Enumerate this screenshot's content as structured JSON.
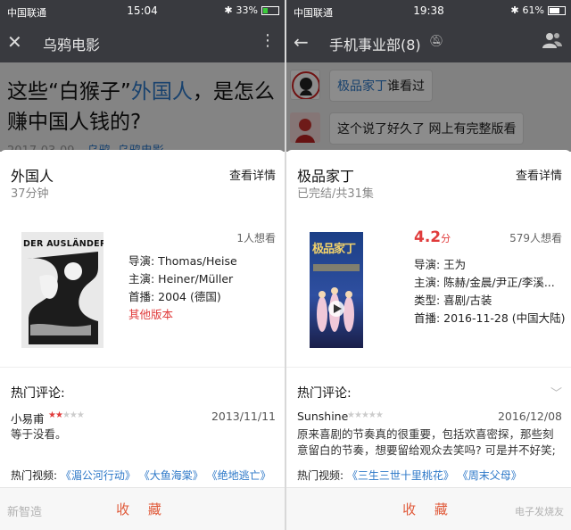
{
  "left": {
    "status": {
      "carrier": "中国联通",
      "time": "15:04",
      "battery": "33%"
    },
    "nav": {
      "close_glyph": "✕",
      "title": "乌鸦电影",
      "more_glyph": "⋮"
    },
    "article": {
      "title_a": "这些“白猴子”",
      "title_hl": "外国人",
      "title_b": "，是怎么赚中国人钱的?",
      "date": "2017-03-09",
      "author_link": "乌鸦",
      "source_link": "乌鸦电影"
    },
    "sheet": {
      "title": "外国人",
      "subtitle": "37分钟",
      "detail": "查看详情",
      "wants": "1人想看",
      "poster_text": "DER AUSLÄNDER",
      "info": [
        "导演: Thomas/Heise",
        "主演: Heiner/Müller",
        "首播: 2004 (德国)"
      ],
      "other_versions": "其他版本",
      "hot_title": "热门评论:",
      "comment_user": "小易甫",
      "comment_stars": 2,
      "comment_date": "2013/11/11",
      "comment_text": "等于没看。",
      "hot_label": "热门视频:",
      "hot_videos": [
        "《湄公河行动》",
        "《大鱼海棠》",
        "《绝地逃亡》"
      ],
      "collect": "收 藏"
    },
    "watermark": "新智造"
  },
  "right": {
    "status": {
      "carrier": "中国联通",
      "time": "19:38",
      "battery": "61%"
    },
    "nav": {
      "back_glyph": "←",
      "title": "手机事业部(8)"
    },
    "chat": {
      "msg1_hl": "极品家丁",
      "msg1_rest": "谁看过",
      "msg2": "这个说了好久了 网上有完整版看"
    },
    "sheet": {
      "title": "极品家丁",
      "subtitle": "已完结/共31集",
      "detail": "查看详情",
      "rating": "4.2",
      "rating_unit": "分",
      "wants": "579人想看",
      "poster_text": "极品家丁",
      "info": [
        "导演: 王为",
        "主演: 陈赫/金晨/尹正/李溪...",
        "类型: 喜剧/古装",
        "首播: 2016-11-28 (中国大陆)"
      ],
      "hot_title": "热门评论:",
      "comment_user": "Sunshine",
      "comment_stars": 0,
      "comment_date": "2016/12/08",
      "comment_text": "原来喜剧的节奏真的很重要，包括欢喜密探，那些刻意留白的节奏，想要留给观众去笑吗? 可是并不好笑;",
      "hot_label": "热门视频:",
      "hot_videos": [
        "《三生三世十里桃花》",
        "《周末父母》"
      ],
      "collect": "收 藏"
    },
    "watermark": "电子发烧友"
  },
  "colors": {
    "accent_red": "#e03b3b",
    "link_blue": "#2d78c8",
    "bar_dark": "#393a3f"
  },
  "icons": [
    "close-icon",
    "more-icon",
    "back-icon",
    "mute-icon",
    "group-icon",
    "wifi-icon",
    "chevron-down-icon",
    "star-icon"
  ]
}
